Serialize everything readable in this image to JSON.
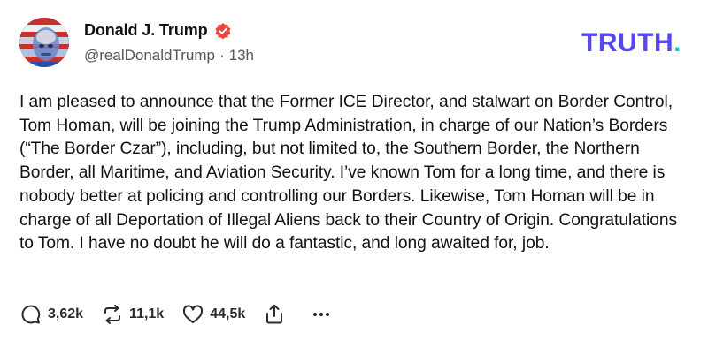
{
  "author": {
    "display_name": "Donald J. Trump",
    "handle": "@realDonaldTrump",
    "separator": "·",
    "time_ago": "13h"
  },
  "brand": {
    "name": "TRUTH",
    "dot": "."
  },
  "post": {
    "text": "I am pleased to announce that the Former ICE Director, and stalwart on Border Control, Tom Homan, will be joining the Trump Administration, in charge of our Nation’s Borders (“The Border Czar”), including, but not limited to, the Southern Border, the Northern Border, all Maritime, and Aviation Security. I’ve known Tom for a long time, and there is nobody better at policing and controlling our Borders. Likewise, Tom Homan will be in charge of all Deportation of Illegal Aliens back to their Country of Origin. Congratulations to Tom. I have no doubt he will do a fantastic, and long awaited for, job."
  },
  "actions": {
    "replies": "3,62k",
    "retruths": "11,1k",
    "likes": "44,5k"
  },
  "icons": {
    "verified": "verified-badge-icon",
    "reply": "reply-bubble-icon",
    "retruth": "retruth-arrows-icon",
    "like": "heart-icon",
    "share": "share-icon",
    "more": "more-dots-icon"
  },
  "colors": {
    "brand": "#5448ee",
    "brand_dot": "#17c7b4",
    "verified_badge": "#e8473c",
    "text": "#121212",
    "muted": "#54545c"
  }
}
